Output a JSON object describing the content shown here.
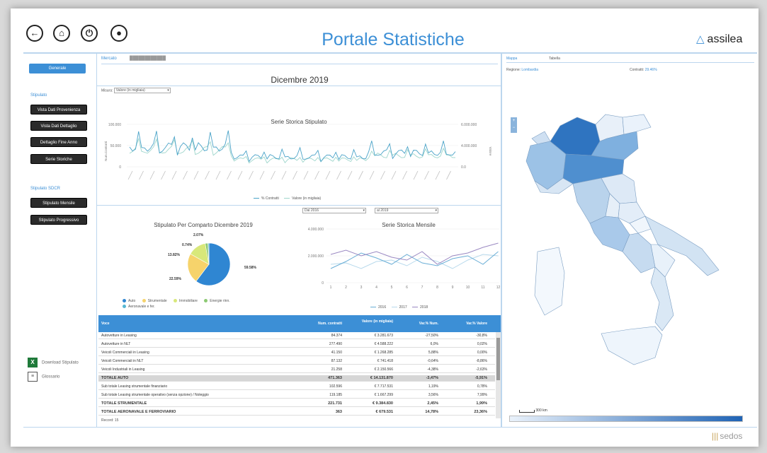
{
  "header": {
    "nav_icons": [
      "back-arrow-icon",
      "home-icon",
      "power-icon",
      "user-icon"
    ],
    "nav_glyphs": [
      "←",
      "⌂",
      "⏻",
      "●"
    ],
    "title": "Portale Statistiche",
    "logo": "assilea",
    "logo_glyph": "△"
  },
  "sidebar": {
    "top_button": "Generale",
    "section1": "Stipulato",
    "buttons1": [
      "Vista Dati Provenienza",
      "Vista Dati Dettaglio",
      "Dettaglio Fine Anno",
      "Serie Storiche"
    ],
    "section2": "Stipulato SDCR",
    "buttons2": [
      "Stipulato Mensile",
      "Stipulato Progressivo"
    ],
    "download": "Download Stipulato",
    "download_icon": "X",
    "glossary": "Glossario",
    "glossary_icon": "≡"
  },
  "center": {
    "tabs": [
      "Mercato",
      "████████████"
    ],
    "period_title": "Dicembre 2019",
    "filter_label": "Misura:",
    "filter_value": "Valore (in migliaia)",
    "series_chart": {
      "title": "Serie Storica Stipulato",
      "y_left_ticks": [
        "100.000",
        "50.000",
        "0"
      ],
      "y_right_ticks": [
        "6.000.000",
        "4.000.000",
        "0.0"
      ],
      "y_left_label": "Num.Contratti",
      "y_right_label": "Valore",
      "legend": [
        "% Contratti",
        "Valore (in migliaia)"
      ]
    },
    "pie_chart": {
      "title": "Stipulato Per Comparto Dicembre 2019",
      "labels": [
        "2.07%",
        "0.74%",
        "13.82%",
        "22.59%",
        "59.58%"
      ],
      "legend": [
        "Auto",
        "Strumentale",
        "Immobiliare",
        "Energie rinn.",
        "Aeronavale e fer."
      ]
    },
    "monthly_chart": {
      "from_label": "Dal 2016",
      "to_label": "al 2019",
      "title": "Serie Storica Mensile",
      "y_ticks": [
        "4.000.000",
        "2.000.000",
        "0"
      ],
      "x_ticks": [
        "1",
        "2",
        "3",
        "4",
        "5",
        "6",
        "7",
        "8",
        "9",
        "10",
        "11",
        "12"
      ],
      "x_label": "Mese",
      "legend": [
        "2016",
        "2017",
        "2018"
      ]
    },
    "table": {
      "headers": [
        "Voce",
        "Num. contratti",
        "Valore (in migliaia)",
        "Var.% Num.",
        "Var.% Valore"
      ],
      "rows": [
        [
          "Autovetture in Leasing",
          "84.374",
          "€ 3.281.673",
          "-27,50%",
          "-30,8%"
        ],
        [
          "Autovetture in NLT",
          "277.490",
          "€ 4.588.222",
          "6,0%",
          "0,02%"
        ],
        [
          "Veicoli Commerciali in Leasing",
          "41.150",
          "€ 1.268.285",
          "5,88%",
          "0,00%"
        ],
        [
          "Veicoli Commerciali in NLT",
          "87.132",
          "€ 741.418",
          "-0,64%",
          "-8,86%"
        ],
        [
          "Veicoli Industriali in Leasing",
          "21.258",
          "€ 2.150.566",
          "-4,38%",
          "-2,63%"
        ],
        [
          "TOTALE AUTO",
          "471.363",
          "€ 14.131.870",
          "-3,47%",
          "-5,91%"
        ],
        [
          "Sub totale Leasing strumentale finanziario",
          "102.596",
          "€ 7.717.531",
          "1,19%",
          "0,78%"
        ],
        [
          "Sub totale Leasing strumentale operativo (senza opzione) / Noleggio",
          "119.185",
          "€ 1.667.299",
          "3,56%",
          "7,99%"
        ],
        [
          "TOTALE STRUMENTALE",
          "221.731",
          "€ 9.384.830",
          "2,45%",
          "1,99%"
        ],
        [
          "TOTALE AERONAVALE E FERROVIARIO",
          "363",
          "€ 679.531",
          "14,78%",
          "23,36%"
        ]
      ],
      "footer": "Record: 15"
    }
  },
  "right": {
    "tabs": [
      "Mappa",
      "Tabella"
    ],
    "region_label": "Regione:",
    "region_value": "Lombardia",
    "share_label": "Contratti:",
    "share_value": "29.46%",
    "zoom": "+\n-",
    "scale": "300 km"
  },
  "footer": {
    "brand": "sedos",
    "brand_glyph": "|||"
  }
}
